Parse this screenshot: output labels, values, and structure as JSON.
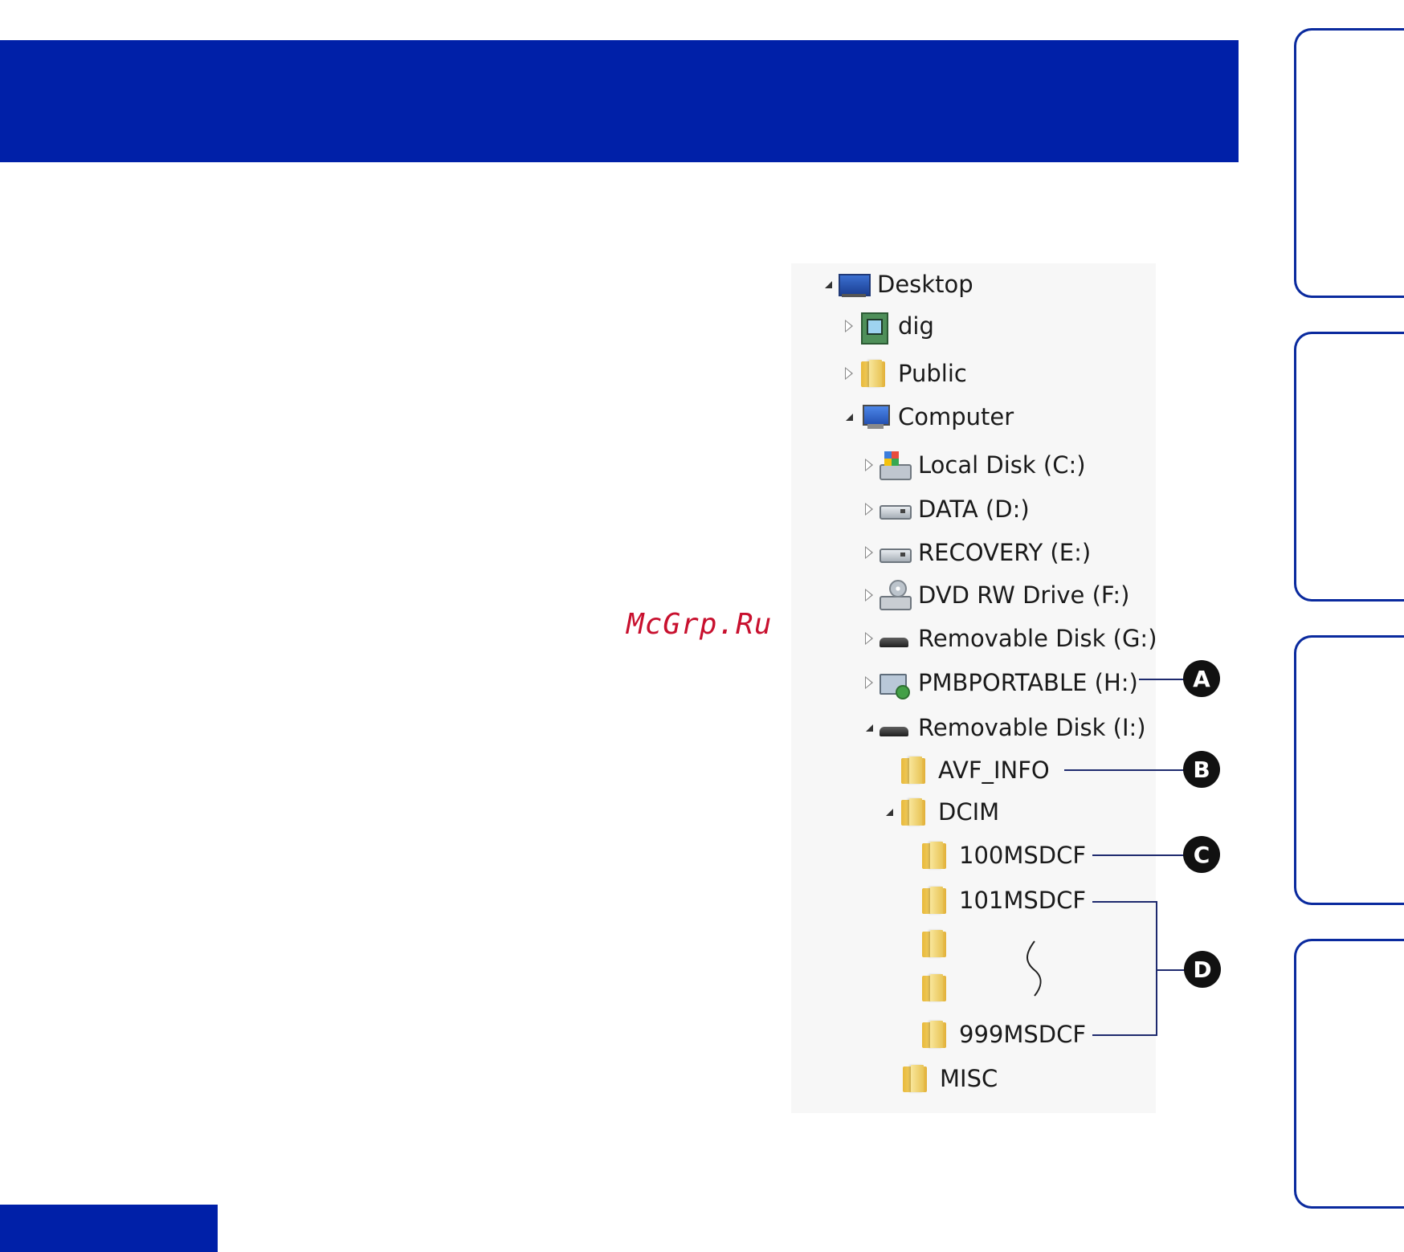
{
  "tree": {
    "desktop": "Desktop",
    "dig": "dig",
    "public": "Public",
    "computer": "Computer",
    "local_disk_c": "Local Disk (C:)",
    "data_d": "DATA (D:)",
    "recovery_e": "RECOVERY (E:)",
    "dvd_f": "DVD RW Drive (F:)",
    "removable_g": "Removable Disk (G:)",
    "pmbportable_h": "PMBPORTABLE (H:)",
    "removable_i": "Removable Disk (I:)",
    "avf_info": "AVF_INFO",
    "dcim": "DCIM",
    "f100": "100MSDCF",
    "f101": "101MSDCF",
    "f999": "999MSDCF",
    "misc": "MISC"
  },
  "callouts": {
    "a": "A",
    "b": "B",
    "c": "C",
    "d": "D"
  },
  "watermark": "McGrp.Ru",
  "icons": {
    "desktop": "desktop-icon",
    "folder": "folder-icon",
    "computer": "computer-icon",
    "drive": "drive-icon",
    "removable": "removable-disk-icon"
  },
  "colors": {
    "banner": "#0020a8",
    "tab_border": "#0a2a9e",
    "watermark": "#c8102e"
  }
}
